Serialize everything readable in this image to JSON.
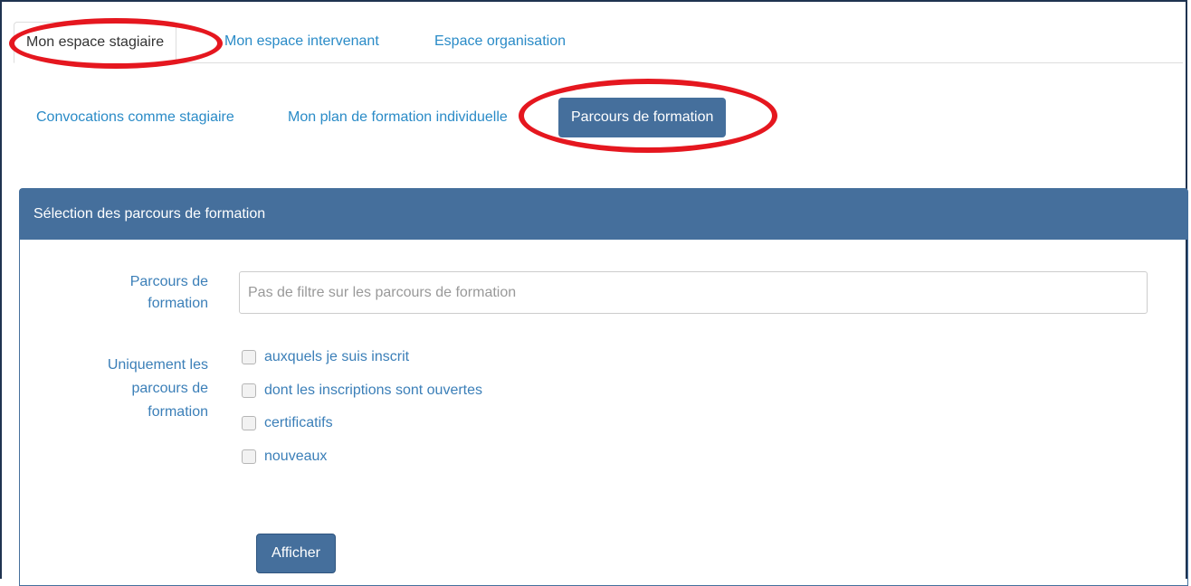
{
  "top_tabs": {
    "stagiaire": "Mon espace stagiaire",
    "intervenant": "Mon espace intervenant",
    "organisation": "Espace organisation"
  },
  "sub_tabs": {
    "convocations": "Convocations comme stagiaire",
    "plan": "Mon plan de formation individuelle",
    "parcours": "Parcours de formation"
  },
  "panel": {
    "title": "Sélection des parcours de formation",
    "parcours_label_line1": "Parcours de",
    "parcours_label_line2": "formation",
    "parcours_placeholder": "Pas de filtre sur les parcours de formation",
    "uniquement_label_line1": "Uniquement les",
    "uniquement_label_line2": "parcours de",
    "uniquement_label_line3": "formation",
    "checkboxes": [
      {
        "label": "auxquels je suis inscrit",
        "checked": false
      },
      {
        "label": "dont les inscriptions sont ouvertes",
        "checked": false
      },
      {
        "label": "certificatifs",
        "checked": false
      },
      {
        "label": "nouveaux",
        "checked": false
      }
    ],
    "submit_label": "Afficher"
  },
  "colors": {
    "accent": "#456f9c",
    "link": "#2a8bc7",
    "highlight_ring": "#e5171f"
  }
}
